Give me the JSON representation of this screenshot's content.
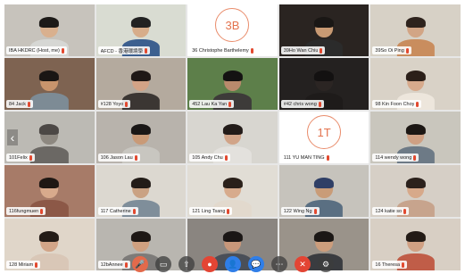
{
  "participants": [
    {
      "name": "IBA HKDRC (Host, me)",
      "avatar_text": "",
      "skin": "#d9b08e",
      "hair": "#1d1a18",
      "shirt": "#d6d7d4",
      "bg": "#c7c3bc"
    },
    {
      "name": "AFCD - 香港環境學",
      "avatar_text": "",
      "skin": "#d7ad8a",
      "hair": "#222",
      "shirt": "#3c5f8f",
      "bg": "#d9dcd2"
    },
    {
      "name": "36 Christophe Barthelemy",
      "avatar_text": "3B",
      "skin": "",
      "hair": "",
      "shirt": "",
      "bg": "#ffffff"
    },
    {
      "name": "39Ho Wan Chiu",
      "avatar_text": "",
      "skin": "#c99a73",
      "hair": "#1a1715",
      "shirt": "#2b2b2b",
      "bg": "#2a2421"
    },
    {
      "name": "39So Oi Ping",
      "avatar_text": "",
      "skin": "#d2a585",
      "hair": "#2e231d",
      "shirt": "#c98d5e",
      "bg": "#d7d1c6"
    },
    {
      "name": "84 Jack",
      "avatar_text": "",
      "skin": "#c8946c",
      "hair": "#1a1614",
      "shirt": "#7d8b95",
      "bg": "#7e6351"
    },
    {
      "name": "#128 Yoyo",
      "avatar_text": "",
      "skin": "#d3a386",
      "hair": "#1f1816",
      "shirt": "#3b3633",
      "bg": "#b4aa9e"
    },
    {
      "name": "452 Lau Ka Yan",
      "avatar_text": "",
      "skin": "#b98a6c",
      "hair": "#141212",
      "shirt": "#3d3b39",
      "bg": "#5d7f4a"
    },
    {
      "name": "#42 chris wong",
      "avatar_text": "",
      "skin": "#2b2523",
      "hair": "#131111",
      "shirt": "#1e1b1a",
      "bg": "#242120"
    },
    {
      "name": "98 Kin Foon Choy",
      "avatar_text": "",
      "skin": "#d7aa8c",
      "hair": "#2b1f19",
      "shirt": "#ede6dc",
      "bg": "#d9d2c7"
    },
    {
      "name": "101Felix",
      "avatar_text": "",
      "skin": "#8d8880",
      "hair": "#4c4845",
      "shirt": "#6b6864",
      "bg": "#bcbab4"
    },
    {
      "name": "106 Jason Lau",
      "avatar_text": "",
      "skin": "#c99a77",
      "hair": "#1a1716",
      "shirt": "#c8c6c0",
      "bg": "#b8b3ac"
    },
    {
      "name": "105 Andy Chu",
      "avatar_text": "",
      "skin": "#d1a488",
      "hair": "#221b18",
      "shirt": "#e3e1dd",
      "bg": "#d8d6d0"
    },
    {
      "name": "111 YU MAN TING",
      "avatar_text": "1T",
      "skin": "",
      "hair": "",
      "shirt": "",
      "bg": "#ffffff"
    },
    {
      "name": "114 wendy wong",
      "avatar_text": "",
      "skin": "#cfa083",
      "hair": "#1c1714",
      "shirt": "#6d7a86",
      "bg": "#c9c6bd"
    },
    {
      "name": "116fungmuen",
      "avatar_text": "",
      "skin": "#d8aa8c",
      "hair": "#1f1814",
      "shirt": "#8c5847",
      "bg": "#a77b68"
    },
    {
      "name": "117 Catherine",
      "avatar_text": "",
      "skin": "#caa283",
      "hair": "#231c18",
      "shirt": "#7f8e9a",
      "bg": "#dcd8d0"
    },
    {
      "name": "121 Ling Tsang",
      "avatar_text": "",
      "skin": "#d7ab8d",
      "hair": "#2a201a",
      "shirt": "#e2d9cd",
      "bg": "#e1ddd5"
    },
    {
      "name": "122 Wing Ng",
      "avatar_text": "",
      "skin": "#c99c78",
      "hair": "#2f3f66",
      "shirt": "#5a6f82",
      "bg": "#c6c3bc"
    },
    {
      "name": "124 katie so",
      "avatar_text": "",
      "skin": "#d7a98a",
      "hair": "#2b211c",
      "shirt": "#c7a48d",
      "bg": "#d6cfc6"
    },
    {
      "name": "128 Miriam",
      "avatar_text": "",
      "skin": "#d2a588",
      "hair": "#241c17",
      "shirt": "#d9c7b7",
      "bg": "#e0d6c9"
    },
    {
      "name": "12bAnnee",
      "avatar_text": "",
      "skin": "#cfa080",
      "hair": "#1d1714",
      "shirt": "#7d7b79",
      "bg": "#b9b6b0"
    },
    {
      "name": "",
      "avatar_text": "",
      "skin": "#c8977a",
      "hair": "#1a1615",
      "shirt": "#4a4f58",
      "bg": "#8a8580"
    },
    {
      "name": "",
      "avatar_text": "",
      "skin": "#cc9d7c",
      "hair": "#1b1715",
      "shirt": "#3a3c40",
      "bg": "#9a938a"
    },
    {
      "name": "16 Theresa",
      "avatar_text": "",
      "skin": "#d0a083",
      "hair": "#231b16",
      "shirt": "#c05d48",
      "bg": "#d8cfc4"
    }
  ],
  "toolbar": [
    {
      "icon": "mic-muted-icon",
      "glyph": "🎤",
      "style": "orange"
    },
    {
      "icon": "video-icon",
      "glyph": "▭",
      "style": ""
    },
    {
      "icon": "share-screen-icon",
      "glyph": "⇧",
      "style": ""
    },
    {
      "icon": "record-icon",
      "glyph": "●",
      "style": "red"
    },
    {
      "icon": "participants-icon",
      "glyph": "👤",
      "style": "blue"
    },
    {
      "icon": "chat-icon",
      "glyph": "💬",
      "style": "blue"
    },
    {
      "icon": "more-icon",
      "glyph": "⋯",
      "style": ""
    },
    {
      "icon": "end-call-icon",
      "glyph": "✕",
      "style": "red"
    },
    {
      "icon": "settings-icon",
      "glyph": "⚙",
      "style": ""
    }
  ]
}
